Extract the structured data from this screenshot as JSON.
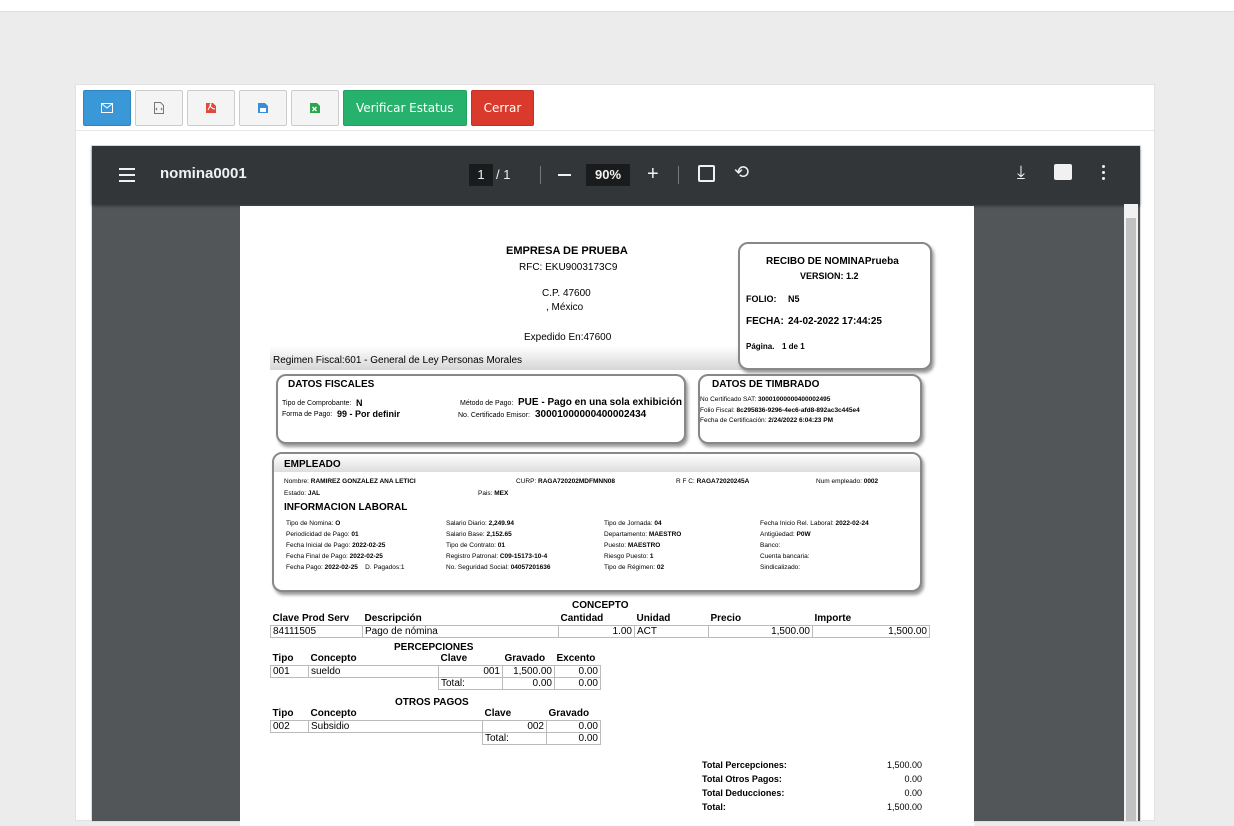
{
  "toolbar": {
    "verify_label": "Verificar Estatus",
    "close_label": "Cerrar"
  },
  "viewer": {
    "filename": "nomina0001",
    "page_current": "1",
    "page_total": "/ 1",
    "zoom": "90%"
  },
  "doc": {
    "company": "EMPRESA DE PRUEBA",
    "rfc": "RFC: EKU9003173C9",
    "cp": "C.P. 47600",
    "country": ", México",
    "expedido": "Expedido En:47600",
    "regimen": "Regimen Fiscal:601 - General de Ley Personas Morales",
    "recibo_title": "RECIBO DE NOMINAPrueba",
    "version": "VERSION:  1.2",
    "folio_label": "FOLIO:",
    "folio": "N5",
    "fecha_label": "FECHA:",
    "fecha": "24-02-2022 17:44:25",
    "pagina_label": "Página.",
    "pagina": "1 de 1",
    "fiscales": {
      "title": "DATOS FISCALES",
      "tipo_label": "Tipo de Comprobante:",
      "tipo": "N",
      "forma_label": "Forma de Pago:",
      "forma": "99 - Por definir",
      "metodo_label": "Método de Pago:",
      "metodo": "PUE - Pago en una sola exhibición",
      "cert_label": "No. Certificado Emisor:",
      "cert": "30001000000400002434"
    },
    "timbrado": {
      "title": "DATOS DE TIMBRADO",
      "sat_label": "No Certificado SAT:",
      "sat": "30001000000400002495",
      "folio_label": "Folio Fiscal:",
      "folio": "8c295836-9296-4ec6-afd8-892ac3c445e4",
      "fecha_label": "Fecha de Certificación:",
      "fecha": "2/24/2022 6:04:23 PM"
    },
    "empleado": {
      "title": "EMPLEADO",
      "nombre_label": "Nombre:",
      "nombre": "RAMIREZ GONZALEZ ANA LETICI",
      "curp_label": "CURP:",
      "curp": "RAGA720202MDFMNN08",
      "rfc_label": "R F C:",
      "rfc": "RAGA72020245A",
      "num_label": "Num empleado:",
      "num": "0002",
      "estado_label": "Estado:",
      "estado": "JAL",
      "pais_label": "Pais:",
      "pais": "MEX",
      "laboral_title": "INFORMACION LABORAL",
      "col1": [
        [
          "Tipo de Nomina:",
          "O"
        ],
        [
          "Periodicidad de Pago:",
          "01"
        ],
        [
          "Fecha Inicial de Pago:",
          "2022-02-25"
        ],
        [
          "Fecha Final de Pago:",
          "2022-02-25"
        ],
        [
          "Fecha Pago:",
          "2022-02-25"
        ]
      ],
      "pagados": "D. Pagados:1",
      "col2": [
        [
          "Salario Diario:",
          "2,249.94"
        ],
        [
          "Salario Base:",
          "2,152.65"
        ],
        [
          "Tipo de Contrato:",
          "01"
        ],
        [
          "Registro Patronal:",
          "C09-15173-10-4"
        ],
        [
          "No. Seguridad Social:",
          "04057201636"
        ]
      ],
      "col3": [
        [
          "Tipo de Jornada:",
          "04"
        ],
        [
          "Departamento:",
          "MAESTRO"
        ],
        [
          "Puesto:",
          "MAESTRO"
        ],
        [
          "Riesgo Puesto:",
          "1"
        ],
        [
          "Tipo de Régimen:",
          "02"
        ]
      ],
      "col4": [
        [
          "Fecha Inicio Rel. Laboral:",
          "2022-02-24"
        ],
        [
          "Antigüedad:",
          "P0W"
        ],
        [
          "Banco:",
          ""
        ],
        [
          "Cuenta bancaria:",
          ""
        ],
        [
          "Sindicalizado:",
          ""
        ]
      ]
    },
    "concepto": {
      "title": "CONCEPTO",
      "headers": [
        "Clave Prod Serv",
        "Descripción",
        "Cantidad",
        "Unidad",
        "Precio",
        "Importe"
      ],
      "row": [
        "84111505",
        "Pago de nómina",
        "1.00",
        "ACT",
        "1,500.00",
        "1,500.00"
      ]
    },
    "percepciones": {
      "title": "PERCEPCIONES",
      "headers": [
        "Tipo",
        "Concepto",
        "Clave",
        "Gravado",
        "Excento"
      ],
      "row": [
        "001",
        "sueldo",
        "001",
        "1,500.00",
        "0.00"
      ],
      "total_label": "Total:",
      "total_gravado": "0.00",
      "total_excento": "0.00"
    },
    "otros": {
      "title": "OTROS PAGOS",
      "headers": [
        "Tipo",
        "Concepto",
        "Clave",
        "Gravado"
      ],
      "row": [
        "002",
        "Subsidio",
        "002",
        "0.00"
      ],
      "total_label": "Total:",
      "total": "0.00"
    },
    "totales": [
      [
        "Total Percepciones:",
        "1,500.00"
      ],
      [
        "Total Otros Pagos:",
        "0.00"
      ],
      [
        "Total Deducciones:",
        "0.00"
      ],
      [
        "Total:",
        "1,500.00"
      ]
    ]
  }
}
